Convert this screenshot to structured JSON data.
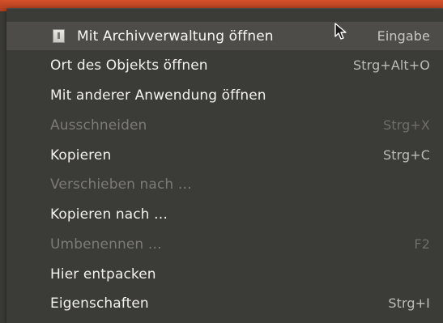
{
  "menu": {
    "items": [
      {
        "label": "Mit Archivverwaltung öffnen",
        "shortcut": "Eingabe",
        "enabled": true,
        "highlighted": true,
        "icon": "archive-icon"
      },
      {
        "label": "Ort des Objekts öffnen",
        "shortcut": "Strg+Alt+O",
        "enabled": true
      },
      {
        "label": "Mit anderer Anwendung öffnen",
        "shortcut": "",
        "enabled": true
      },
      {
        "label": "Ausschneiden",
        "shortcut": "Strg+X",
        "enabled": false
      },
      {
        "label": "Kopieren",
        "shortcut": "Strg+C",
        "enabled": true
      },
      {
        "label": "Verschieben nach …",
        "shortcut": "",
        "enabled": false
      },
      {
        "label": "Kopieren nach …",
        "shortcut": "",
        "enabled": true
      },
      {
        "label": "Umbenennen …",
        "shortcut": "F2",
        "enabled": false
      },
      {
        "label": "Hier entpacken",
        "shortcut": "",
        "enabled": true
      },
      {
        "label": "Eigenschaften",
        "shortcut": "Strg+I",
        "enabled": true
      }
    ]
  },
  "colors": {
    "menu_background": "#3b3b37",
    "highlight_background": "#4d4c48",
    "enabled_text": "#f2f1ee",
    "disabled_text": "#7c7b76",
    "accent_top_strip": "#d4502a"
  },
  "pointer": "arrow-cursor-icon"
}
